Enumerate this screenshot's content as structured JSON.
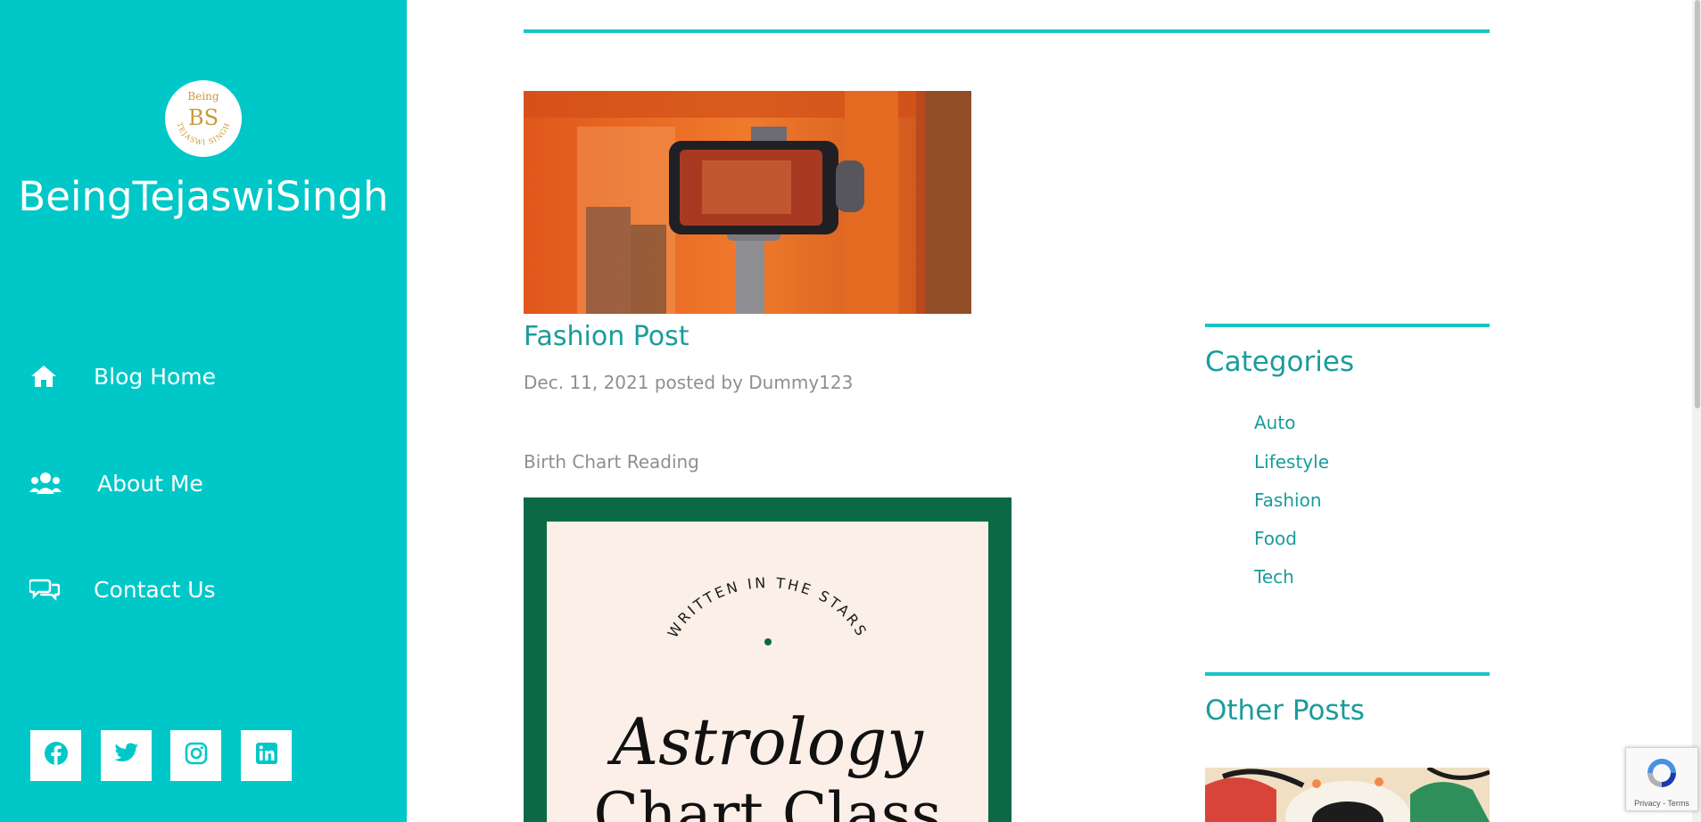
{
  "sidebar": {
    "logo": {
      "line1": "Being",
      "monogram": "BS",
      "ring_text": "TEJASWI SINGH"
    },
    "site_title": "BeingTejaswiSingh",
    "nav": [
      {
        "label": "Blog Home",
        "icon": "home-icon"
      },
      {
        "label": "About Me",
        "icon": "users-icon"
      },
      {
        "label": "Contact Us",
        "icon": "comments-icon"
      }
    ],
    "social": [
      {
        "icon": "facebook-icon"
      },
      {
        "icon": "twitter-icon"
      },
      {
        "icon": "instagram-icon"
      },
      {
        "icon": "linkedin-icon"
      }
    ]
  },
  "post": {
    "title": "Fashion Post",
    "meta": "Dec. 11, 2021 posted by Dummy123",
    "excerpt": "Birth Chart Reading",
    "image2": {
      "arc_text": "WRITTEN IN THE STARS",
      "title_line1": "Astrology",
      "title_line2": "Chart Class"
    }
  },
  "widgets": {
    "categories_title": "Categories",
    "categories": [
      "Auto",
      "Lifestyle",
      "Fashion",
      "Food",
      "Tech"
    ],
    "other_posts_title": "Other Posts"
  },
  "recaptcha": {
    "text": "Privacy - Terms"
  },
  "colors": {
    "accent": "#00c8c8",
    "link": "#1a9c9c",
    "muted": "#8f8f8f",
    "astro_green": "#0b6a45"
  }
}
